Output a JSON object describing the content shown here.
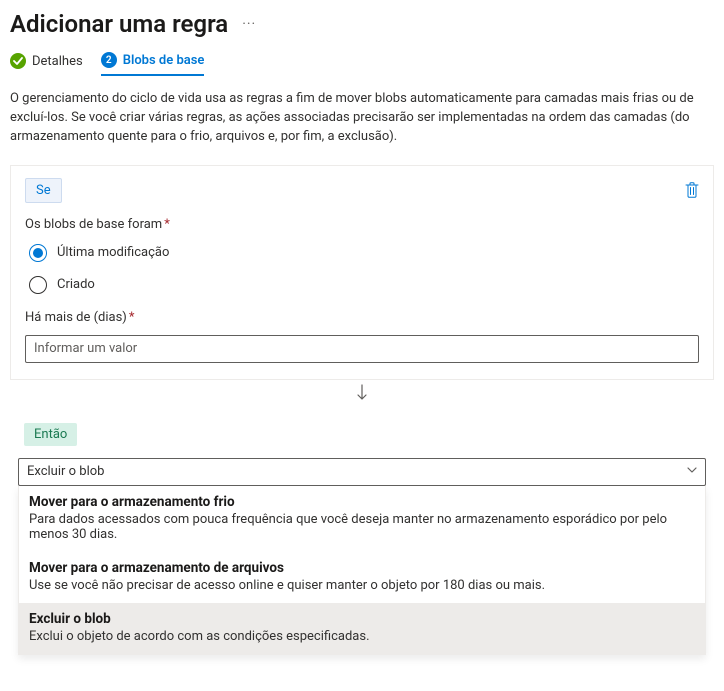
{
  "header": {
    "title": "Adicionar uma regra"
  },
  "tabs": {
    "details": {
      "label": "Detalhes",
      "index": ""
    },
    "base_blobs": {
      "label": "Blobs de base",
      "index": "2"
    }
  },
  "description": "O gerenciamento do ciclo de vida usa as regras a fim de mover blobs automaticamente para camadas mais frias ou de excluí-los. Se você criar várias regras, as ações associadas precisarão ser implementadas na ordem das camadas (do armazenamento quente para o frio, arquivos e, por fim, a exclusão).",
  "if_block": {
    "badge": "Se",
    "label_base_blobs": "Os blobs de base foram",
    "radio_last_modified": "Última modificação",
    "radio_created": "Criado",
    "label_days": "Há mais de (dias)",
    "days_placeholder": "Informar um valor"
  },
  "then_block": {
    "badge": "Então",
    "selected_label": "Excluir o blob"
  },
  "options": [
    {
      "title": "Mover para o armazenamento frio",
      "desc": "Para dados acessados com pouca frequência que você deseja manter no armazenamento esporádico por pelo menos 30 dias."
    },
    {
      "title": "Mover para o armazenamento de arquivos",
      "desc": "Use se você não precisar de acesso online e quiser manter o objeto por 180 dias ou mais."
    },
    {
      "title": "Excluir o blob",
      "desc": "Exclui o objeto de acordo com as condições especificadas."
    }
  ]
}
